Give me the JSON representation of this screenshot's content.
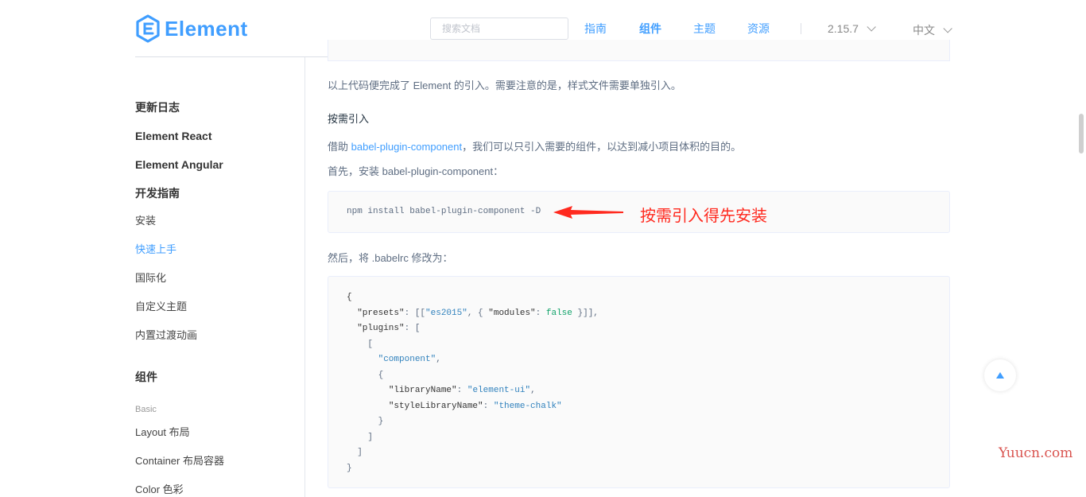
{
  "header": {
    "logo_text": "Element",
    "search_placeholder": "搜索文档",
    "nav": [
      {
        "label": "指南"
      },
      {
        "label": "组件",
        "active": true
      },
      {
        "label": "主题"
      },
      {
        "label": "资源"
      }
    ],
    "version": "2.15.7",
    "language": "中文"
  },
  "sidebar": {
    "items": [
      {
        "label": "更新日志"
      },
      {
        "label": "Element React"
      },
      {
        "label": "Element Angular"
      },
      {
        "label": "开发指南"
      },
      {
        "label": "安装"
      },
      {
        "label": "快速上手",
        "active": true
      },
      {
        "label": "国际化"
      },
      {
        "label": "自定义主题"
      },
      {
        "label": "内置过渡动画"
      },
      {
        "label": "组件"
      },
      {
        "label": "Basic"
      },
      {
        "label": "Layout 布局"
      },
      {
        "label": "Container 布局容器"
      },
      {
        "label": "Color 色彩"
      }
    ]
  },
  "content": {
    "p1": "以上代码便完成了 Element 的引入。需要注意的是，样式文件需要单独引入。",
    "heading": "按需引入",
    "p2_prefix": "借助 ",
    "p2_link": "babel-plugin-component",
    "p2_suffix": "，我们可以只引入需要的组件，以达到减小项目体积的目的。",
    "p3": "首先，安装 babel-plugin-component：",
    "install_cmd": "npm install babel-plugin-component -D",
    "annotation": "按需引入得先安装",
    "p4": "然后，将 .babelrc 修改为：",
    "babelrc": {
      "line1": "{",
      "presets_key": "\"presets\"",
      "presets_val_str": "\"es2015\"",
      "modules_key": "\"modules\"",
      "modules_val": "false",
      "plugins_key": "\"plugins\"",
      "component_str": "\"component\"",
      "library_key": "\"libraryName\"",
      "library_val": "\"element-ui\"",
      "style_key": "\"styleLibraryName\"",
      "style_val": "\"theme-chalk\""
    }
  },
  "watermark": "Yuucn.com"
}
